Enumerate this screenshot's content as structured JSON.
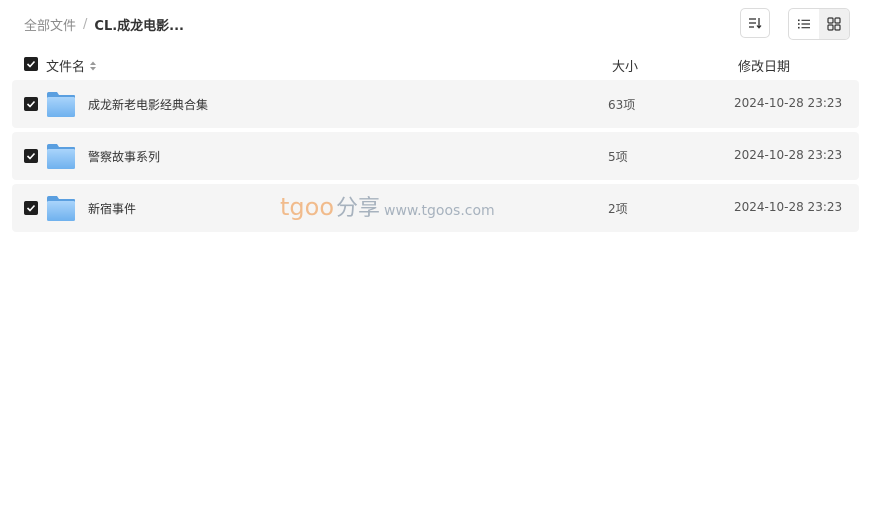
{
  "breadcrumb": {
    "root": "全部文件",
    "separator": "/",
    "current": "CL.成龙电影..."
  },
  "toolbar": {
    "sort_icon": "sort-icon",
    "list_view_icon": "list-view-icon",
    "grid_view_icon": "grid-view-icon"
  },
  "table": {
    "columns": {
      "name": "文件名",
      "size": "大小",
      "date": "修改日期"
    },
    "rows": [
      {
        "name": "成龙新老电影经典合集",
        "size": "63项",
        "date": "2024-10-28 23:23"
      },
      {
        "name": "警察故事系列",
        "size": "5项",
        "date": "2024-10-28 23:23"
      },
      {
        "name": "新宿事件",
        "size": "2项",
        "date": "2024-10-28 23:23"
      }
    ]
  },
  "watermark": {
    "brand": "tgoo",
    "share": "分享",
    "url": "www.tgoos.com"
  },
  "colors": {
    "row_bg": "#f5f5f5",
    "checkbox": "#1f1f1f",
    "folder": "#7cb8f0",
    "watermark_orange": "#f1b27a",
    "watermark_gray": "#9aa7b5"
  }
}
